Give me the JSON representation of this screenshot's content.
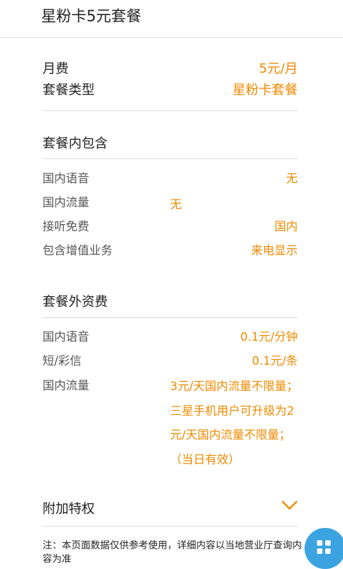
{
  "header": {
    "title": "星粉卡5元套餐"
  },
  "summary": {
    "fee_label": "月费",
    "fee_value": "5元/月",
    "type_label": "套餐类型",
    "type_value": "星粉卡套餐"
  },
  "included": {
    "title": "套餐内包含",
    "items": [
      {
        "label": "国内语音",
        "value": "无"
      },
      {
        "label": "国内流量",
        "value": "无"
      },
      {
        "label": "接听免费",
        "value": "国内"
      },
      {
        "label": "包含增值业务",
        "value": "来电显示"
      }
    ]
  },
  "extra": {
    "title": "套餐外资费",
    "items": [
      {
        "label": "国内语音",
        "value": "0.1元/分钟"
      },
      {
        "label": "短/彩信",
        "value": "0.1元/条"
      },
      {
        "label": "国内流量",
        "value": "3元/天国内流量不限量；三星手机用户可升级为2元/天国内流量不限量；（当日有效）"
      }
    ]
  },
  "privilege": {
    "title": "附加特权",
    "icon": "chevron-down-icon"
  },
  "note": "注：本页面数据仅供参考使用，详细内容以当地营业厅查询内容为准",
  "colors": {
    "accent": "#f08a00",
    "fab": "#3aa3e0"
  }
}
